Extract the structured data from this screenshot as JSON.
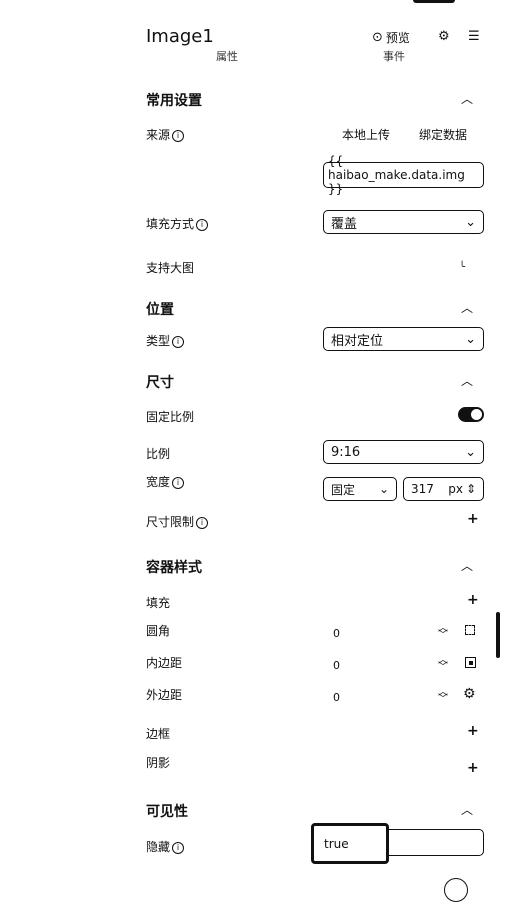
{
  "header": {
    "title": "Image1",
    "preview_label": "预览",
    "tab_left": "属性",
    "tab_right": "事件"
  },
  "common": {
    "title": "常用设置",
    "source_label": "来源",
    "upload_label": "本地上传",
    "bind_label": "绑定数据",
    "source_value": "{{ haibao_make.data.img }}",
    "fill_label": "填充方式",
    "fill_value": "覆盖",
    "zoom_label": "支持大图"
  },
  "position": {
    "title": "位置",
    "type_label": "类型",
    "type_value": "相对定位"
  },
  "size": {
    "title": "尺寸",
    "fixed_ratio_label": "固定比例",
    "ratio_label": "比例",
    "ratio_value": "9:16",
    "width_label": "宽度",
    "width_mode": "固定",
    "width_value": "317",
    "width_unit": "px",
    "limit_label": "尺寸限制"
  },
  "container": {
    "title": "容器样式",
    "fill_label": "填充",
    "radius_label": "圆角",
    "radius_value": "0",
    "padding_label": "内边距",
    "padding_value": "0",
    "margin_label": "外边距",
    "margin_value": "0",
    "border_label": "边框",
    "shadow_label": "阴影"
  },
  "visibility": {
    "title": "可见性",
    "hidden_label": "隐藏",
    "hidden_value": "true"
  }
}
